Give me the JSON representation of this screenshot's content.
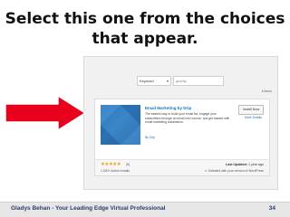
{
  "slide": {
    "title_line1": "Select this one from the choices",
    "title_line2": "that appear."
  },
  "search": {
    "dropdown_value": "Keyword",
    "query": "gravity"
  },
  "results": {
    "count_text": "6 items"
  },
  "plugin": {
    "title": "Email Marketing by Drip",
    "description": "The easiest way to build your email list, engage your subscribers through an email mini course, and get started with email marketing automation.",
    "author": "By Drip",
    "install_label": "Install Now",
    "more_details_label": "More Details",
    "stars": "★★★★★",
    "rating_count": "(9)",
    "installs": "1,000+ Active Installs",
    "last_updated_label": "Last Updated:",
    "last_updated_value": "1 year ago",
    "compat_check": "✔",
    "compatibility": "Untested with your version of WordPress",
    "rating": 5
  },
  "footer": {
    "text": "Gladys Behan - Your Leading Edge Virtual Professional",
    "page": "34"
  },
  "colors": {
    "arrow": "#e8001c",
    "link": "#1a73b8",
    "star": "#f0a020",
    "footer_text": "#2a3e6a"
  }
}
